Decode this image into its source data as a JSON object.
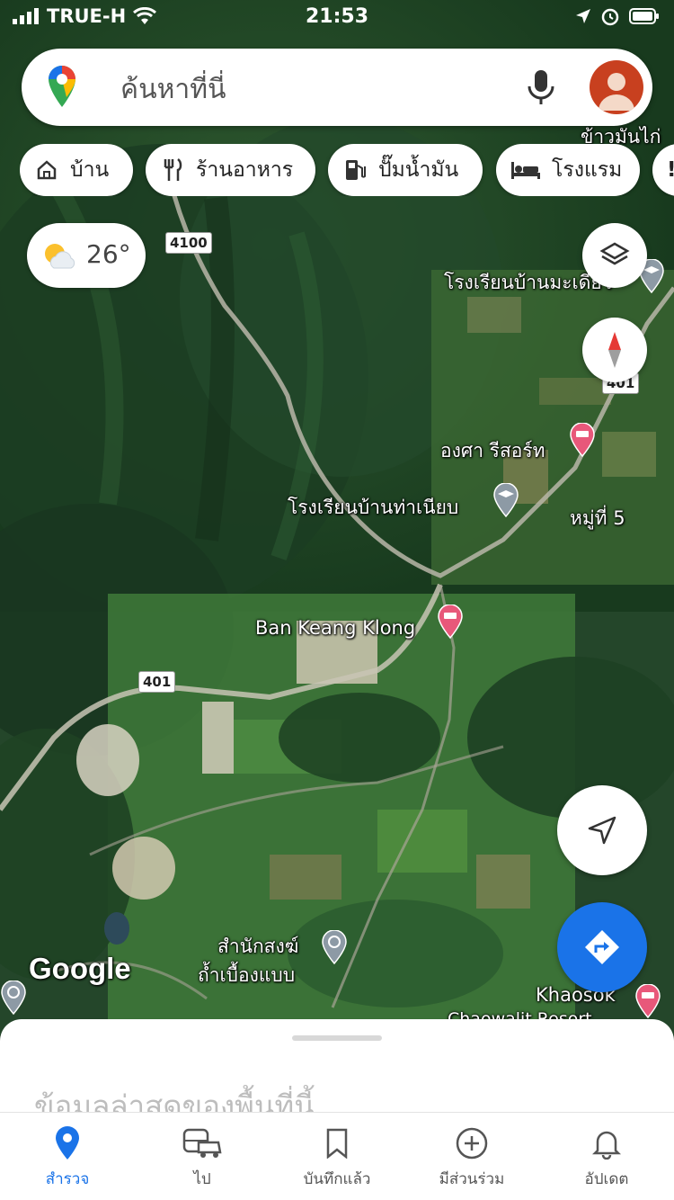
{
  "status_bar": {
    "carrier": "TRUE-H",
    "time": "21:53",
    "icons": [
      "signal-icon",
      "wifi-icon",
      "location-arrow-icon",
      "alarm-icon",
      "battery-icon"
    ]
  },
  "search": {
    "placeholder": "ค้นหาที่นี่"
  },
  "chips": [
    {
      "label": "บ้าน",
      "icon": "home-icon"
    },
    {
      "label": "ร้านอาหาร",
      "icon": "restaurant-icon"
    },
    {
      "label": "ปั๊มน้ำมัน",
      "icon": "gas-station-icon"
    },
    {
      "label": "โรงแรม",
      "icon": "hotel-icon"
    }
  ],
  "weather": {
    "temperature": "26°",
    "icon": "partly-cloudy-icon"
  },
  "map": {
    "labels": {
      "school_top": "โรงเรียนบ้านมะเดี่ยว",
      "cut_top_right": "ข้าวมันไก่",
      "resort": "องศา รีสอร์ท",
      "school_mid": "โรงเรียนบ้านท่าเนียบ",
      "village": "หมู่ที่ 5",
      "ban_keang_klong": "Ban Keang Klong",
      "temple_line1": "สำนักสงฆ์",
      "temple_line2": "ถ้ำเบื้องแบบ",
      "khaosok": "Khaosok",
      "khaosok_cut": "Chaowalit Resort"
    },
    "road_shields": {
      "r4100": "4100",
      "r401": "401",
      "r401_top": "401"
    },
    "attribution": "Google"
  },
  "bottom_sheet": {
    "title": "ข้อมูลล่าสุดของพื้นที่นี้..."
  },
  "tabs": [
    {
      "label": "สำรวจ",
      "icon": "explore-pin-icon",
      "active": true
    },
    {
      "label": "ไป",
      "icon": "commute-icon",
      "active": false
    },
    {
      "label": "บันทึกแล้ว",
      "icon": "bookmark-icon",
      "active": false
    },
    {
      "label": "มีส่วนร่วม",
      "icon": "add-circle-icon",
      "active": false
    },
    {
      "label": "อัปเดต",
      "icon": "bell-icon",
      "active": false
    }
  ],
  "colors": {
    "accent": "#1a73e8",
    "pin_pink": "#e8587a",
    "avatar": "#c8401f"
  }
}
